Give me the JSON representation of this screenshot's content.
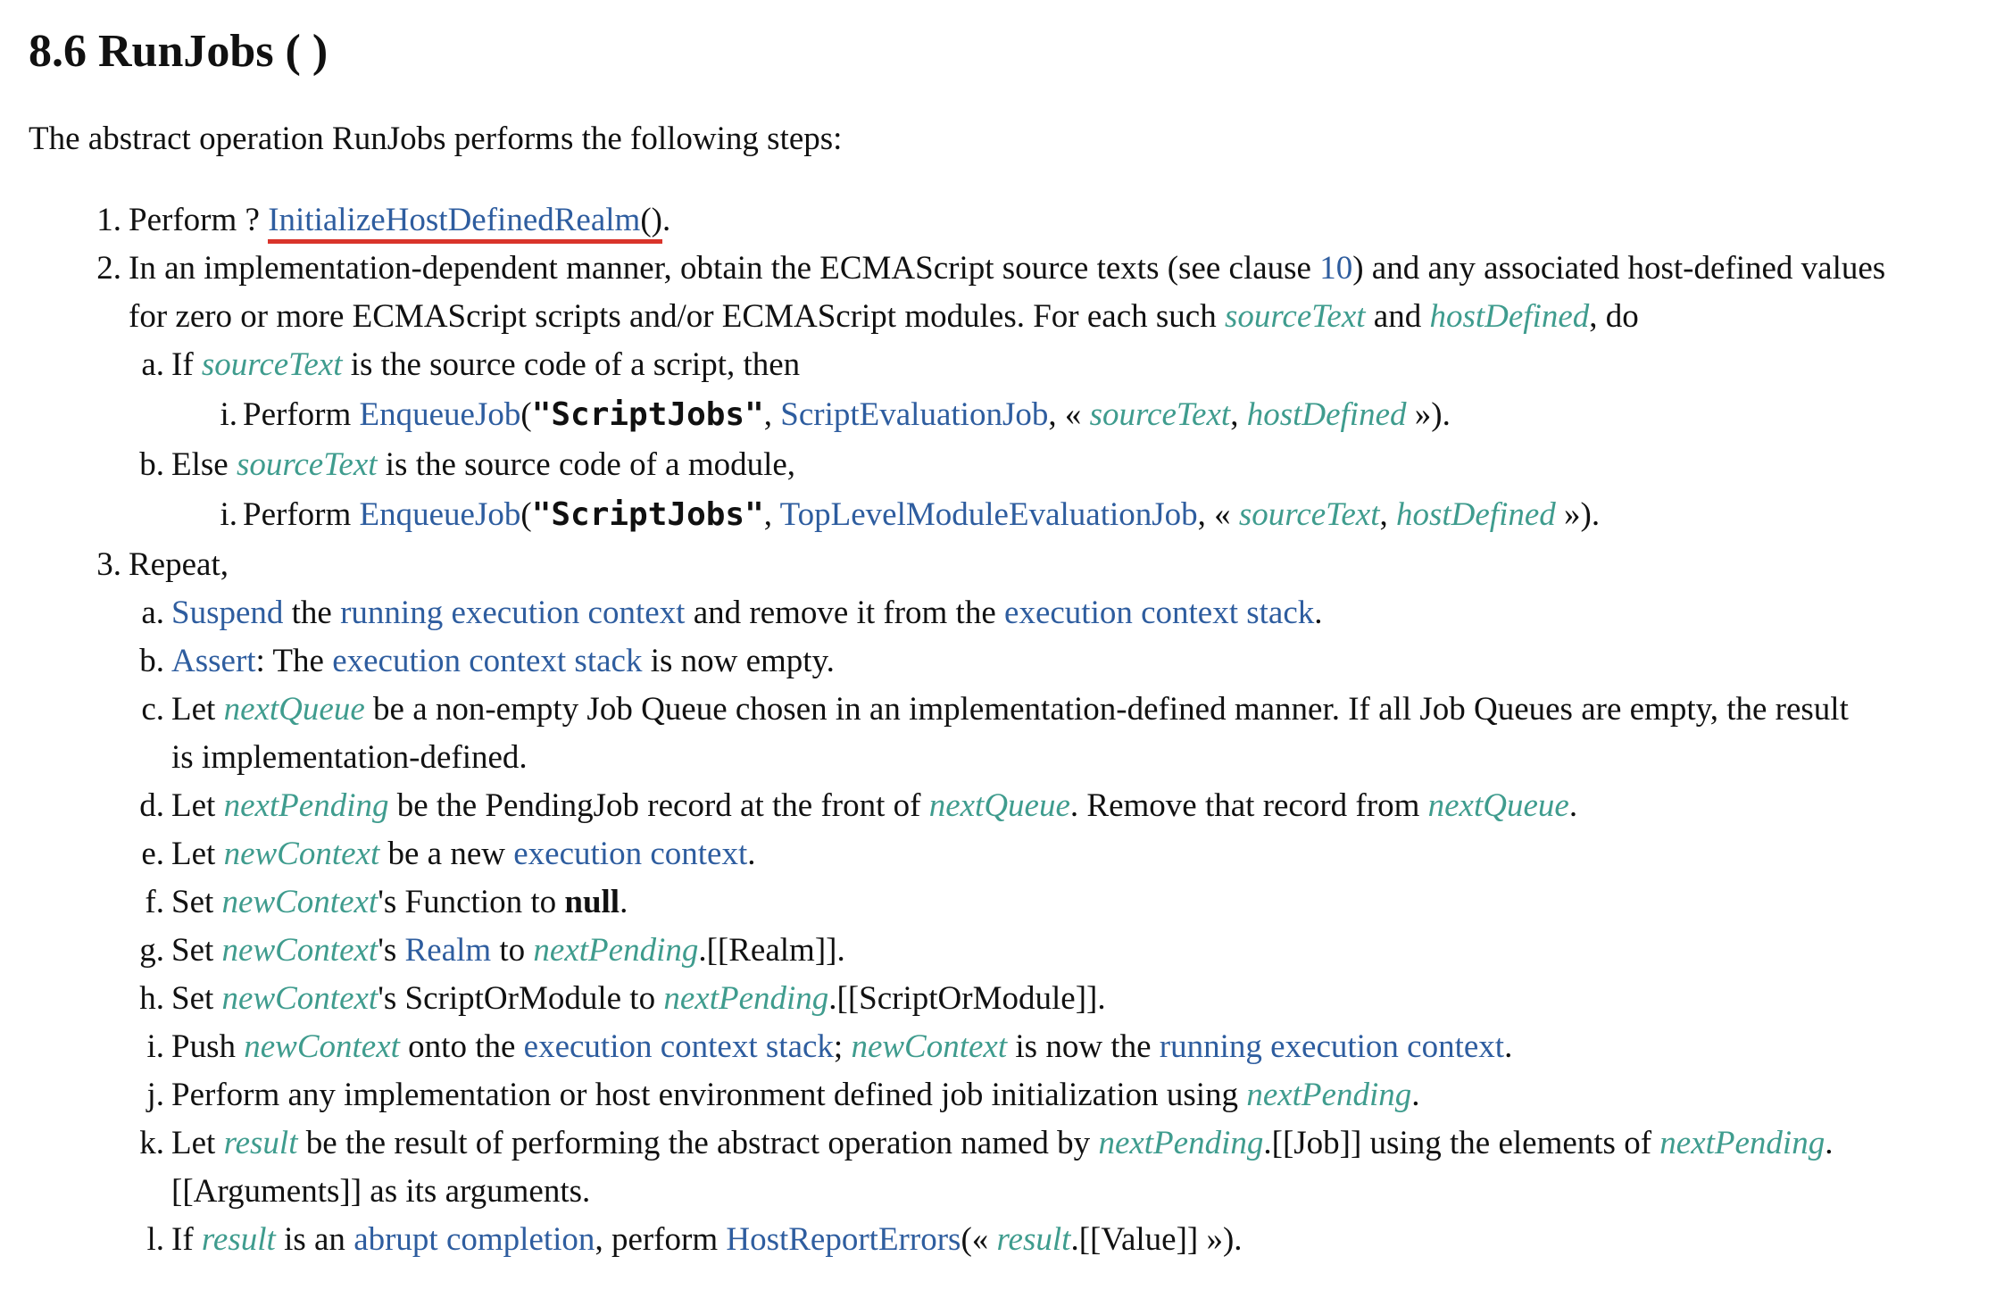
{
  "section": {
    "number": "8.6",
    "title": "RunJobs ( )"
  },
  "intro": "The abstract operation RunJobs performs the following steps:",
  "markers": {
    "s1": "1.",
    "s2": "2.",
    "s3": "3.",
    "a": "a.",
    "b": "b.",
    "c": "c.",
    "d": "d.",
    "e": "e.",
    "f": "f.",
    "g": "g.",
    "h": "h.",
    "i": "i.",
    "j": "j.",
    "k": "k.",
    "l": "l.",
    "roman_i": "i."
  },
  "tokens": {
    "perform": "Perform",
    "q": "?",
    "paren_open": "(",
    "paren_close": ")",
    "paren_close_dot": ").",
    "comma": ",",
    "space": " ",
    "dot": ".",
    "guillemet_open": "«",
    "guillemet_close": "»).",
    "colon": ":",
    "semicolon": ";",
    "possessive": "'s",
    "let": "Let",
    "set": "Set",
    "if": "If",
    "to": "to",
    "realm_field": ".[[Realm]].",
    "som_field": ".[[ScriptOrModule]].",
    "job_field": ".[[Job]] using the elements of",
    "value_field": ".[[Value]] »)."
  },
  "links": {
    "initialize_host_defined_realm": "InitializeHostDefinedRealm",
    "clause_10": "10",
    "enqueue_job": "EnqueueJob",
    "script_evaluation_job": "ScriptEvaluationJob",
    "top_level_module_evaluation_job": "TopLevelModuleEvaluationJob",
    "suspend": "Suspend",
    "running_execution_context": "running execution context",
    "execution_context_stack": "execution context stack",
    "assert": "Assert",
    "execution_context": "execution context",
    "realm": "Realm",
    "abrupt_completion": "abrupt completion",
    "host_report_errors": "HostReportErrors"
  },
  "vars": {
    "sourceText": "sourceText",
    "hostDefined": "hostDefined",
    "nextQueue": "nextQueue",
    "nextPending": "nextPending",
    "newContext": "newContext",
    "result": "result"
  },
  "code": {
    "script_jobs": "\"ScriptJobs\""
  },
  "bold": {
    "null": "null"
  },
  "text": {
    "s2_l1_a": "In an implementation-dependent manner, obtain the ECMAScript source texts (see clause",
    "s2_l1_b": ") and any associated host-defined values",
    "s2_l2_a": "for zero or more ECMAScript scripts and/or ECMAScript modules. For each such",
    "and": "and",
    "do": ", do",
    "s2a_if": "If",
    "s2a_rest": "is the source code of a script, then",
    "s2b_else": "Else",
    "s2b_rest": "is the source code of a module,",
    "s3_repeat": "Repeat,",
    "s3a_the": "the",
    "s3a_remove": "and remove it from the",
    "s3b_the": ": The",
    "s3b_rest": "is now empty.",
    "s3c_rest": "be a non-empty Job Queue chosen in an implementation-defined manner. If all Job Queues are empty, the result",
    "s3c_l2": "is implementation-defined.",
    "s3d_rest": "be the PendingJob record at the front of",
    "s3d_remove": ". Remove that record from",
    "s3e_rest": "be a new",
    "s3f_rest": "'s Function to",
    "s3h_rest": "'s ScriptOrModule to",
    "s3i_push": "Push",
    "s3i_onto": "onto the",
    "s3i_now": "is now the",
    "s3j": "Perform any implementation or host environment defined job initialization using",
    "s3k_rest": "be the result of performing the abstract operation named by",
    "s3k_l2": "[[Arguments]] as its arguments.",
    "s3l_is": "is an",
    "s3l_perform": ", perform",
    "s3l_open": "(«"
  }
}
